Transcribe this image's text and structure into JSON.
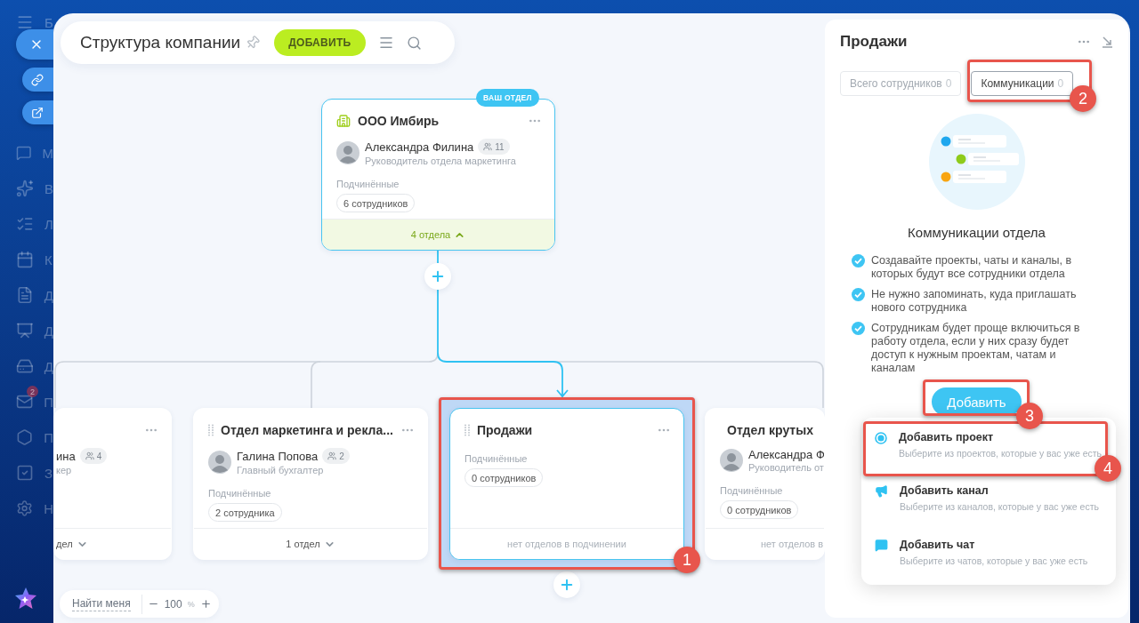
{
  "sidebar": {
    "items": [
      {
        "kind": "menu",
        "letter": "Б"
      },
      {
        "kind": "chat",
        "letter": "М"
      },
      {
        "kind": "sparkle",
        "letter": "В"
      },
      {
        "kind": "list",
        "letter": "Л"
      },
      {
        "kind": "calendar",
        "letter": "К"
      },
      {
        "kind": "doc",
        "letter": "Д"
      },
      {
        "kind": "board",
        "letter": "Д"
      },
      {
        "kind": "drive",
        "letter": "Д"
      },
      {
        "kind": "mail",
        "letter": "П",
        "badge": "2"
      },
      {
        "kind": "hexagon",
        "letter": "П"
      },
      {
        "kind": "task",
        "letter": "З"
      },
      {
        "kind": "gear",
        "letter": "Н"
      }
    ]
  },
  "header": {
    "title": "Структура компании",
    "add_button": "ДОБАВИТЬ"
  },
  "chart_nodes": [
    {
      "kind": "root",
      "selected": false,
      "badge": "ВАШ ОТДЕЛ",
      "title": "ООО Имбирь",
      "head": {
        "name": "Александра Филина",
        "count": "11",
        "position": "Руководитель отдела маркетинга"
      },
      "subordinates_label": "Подчинённые",
      "subordinates": "6 сотрудников",
      "footer": "4 отдела",
      "expanded": true
    },
    {
      "kind": "partial",
      "selected": false,
      "head": {
        "name": "ина",
        "count": "4",
        "position": "кер"
      },
      "footer": "дел",
      "expanded": false
    },
    {
      "kind": "department",
      "selected": false,
      "title": "Отдел маркетинга и рекла...",
      "head": {
        "name": "Галина Попова",
        "count": "2",
        "position": "Главный бухгалтер"
      },
      "subordinates_label": "Подчинённые",
      "subordinates": "2 сотрудника",
      "footer": "1 отдел",
      "expanded": false
    },
    {
      "kind": "department",
      "selected": true,
      "title": "Продажи",
      "subordinates_label": "Подчинённые",
      "subordinates": "0 сотрудников",
      "footer": "нет отделов в подчинении"
    },
    {
      "kind": "cut",
      "selected": false,
      "title": "Отдел крутых",
      "head": {
        "name": "Александра Ф",
        "position": "Руководитель от"
      },
      "subordinates_label": "Подчинённые",
      "subordinates": "0 сотрудников",
      "footer": "нет отделов в"
    }
  ],
  "zoom": {
    "find_me": "Найти меня",
    "value": "100",
    "unit": "%"
  },
  "panel": {
    "title": "Продажи",
    "tabs": [
      {
        "label": "Всего сотрудников",
        "count": "0",
        "selected": false
      },
      {
        "label": "Коммуникации",
        "count": "0",
        "selected": true
      }
    ],
    "heading": "Коммуникации отдела",
    "benefits": [
      "Создавайте проекты, чаты и каналы, в которых будут все сотрудники отдела",
      "Не нужно запоминать, куда приглашать нового сотрудника",
      "Сотрудникам будет проще включиться в работу отдела, если у них сразу будет доступ к нужным проектам, чатам и каналам"
    ],
    "add_button": "Добавить",
    "menu": [
      {
        "kind": "project",
        "title": "Добавить проект",
        "description": "Выберите из проектов, которые у вас уже есть"
      },
      {
        "kind": "channel",
        "title": "Добавить канал",
        "description": "Выберите из каналов, которые у вас уже есть"
      },
      {
        "kind": "chat",
        "title": "Добавить чат",
        "description": "Выберите из чатов, которые у вас уже есть"
      }
    ]
  },
  "annotations": [
    {
      "number": "1"
    },
    {
      "number": "2"
    },
    {
      "number": "3"
    },
    {
      "number": "4"
    }
  ]
}
